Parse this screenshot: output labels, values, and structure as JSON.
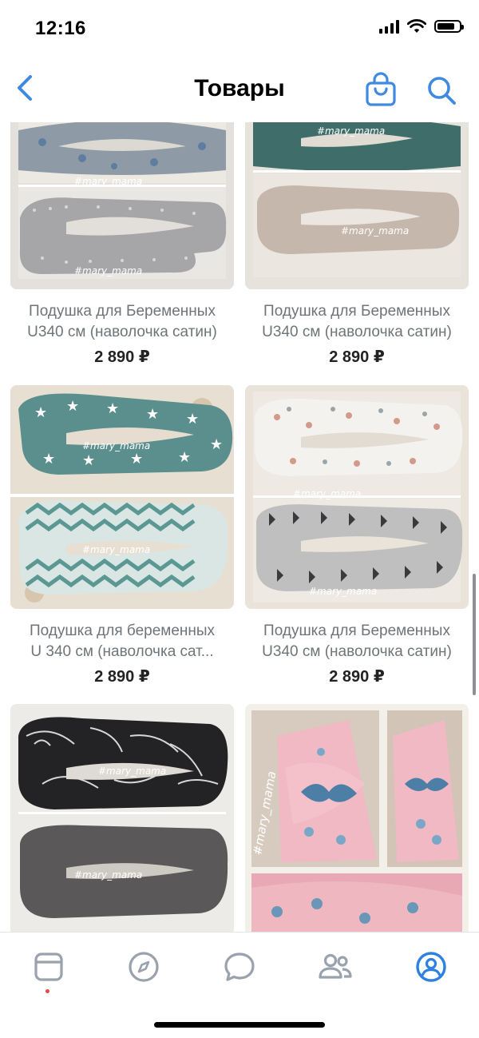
{
  "status_bar": {
    "time": "12:16",
    "battery_level": 0.7
  },
  "nav": {
    "title": "Товары",
    "icons": [
      "chevron-left-icon",
      "shopping-bag-icon",
      "search-icon"
    ]
  },
  "products": [
    {
      "title": "Подушка для Беременных U340 см (наволочка сатин)",
      "title_line1": "Подушка для Беременных",
      "title_line2": "U340 см (наволочка сатин)",
      "price": "2 890 ₽"
    },
    {
      "title": "Подушка для Беременных U340 см (наволочка сатин)",
      "title_line1": "Подушка для Беременных",
      "title_line2": "U340 см (наволочка сатин)",
      "price": "2 890 ₽"
    },
    {
      "title": "Подушка для беременных U 340 см (наволочка сат...",
      "title_line1": "Подушка для беременных",
      "title_line2": "U 340 см (наволочка сат...",
      "price": "2 890 ₽"
    },
    {
      "title": "Подушка для Беременных U340 см (наволочка сатин)",
      "title_line1": "Подушка для Беременных",
      "title_line2": "U340 см (наволочка сатин)",
      "price": "2 890 ₽"
    },
    {
      "title": "",
      "price": ""
    },
    {
      "title": "",
      "price": ""
    }
  ],
  "watermark": "#mary_mama",
  "tab_bar": {
    "tabs": [
      "feed-icon",
      "discover-icon",
      "messages-icon",
      "friends-icon",
      "profile-icon"
    ],
    "active_tab": "profile-icon",
    "accent_color": "#2d81e0"
  },
  "colors": {
    "accent": "#3f8ae0",
    "price": "#222222",
    "title": "#6f7479"
  }
}
